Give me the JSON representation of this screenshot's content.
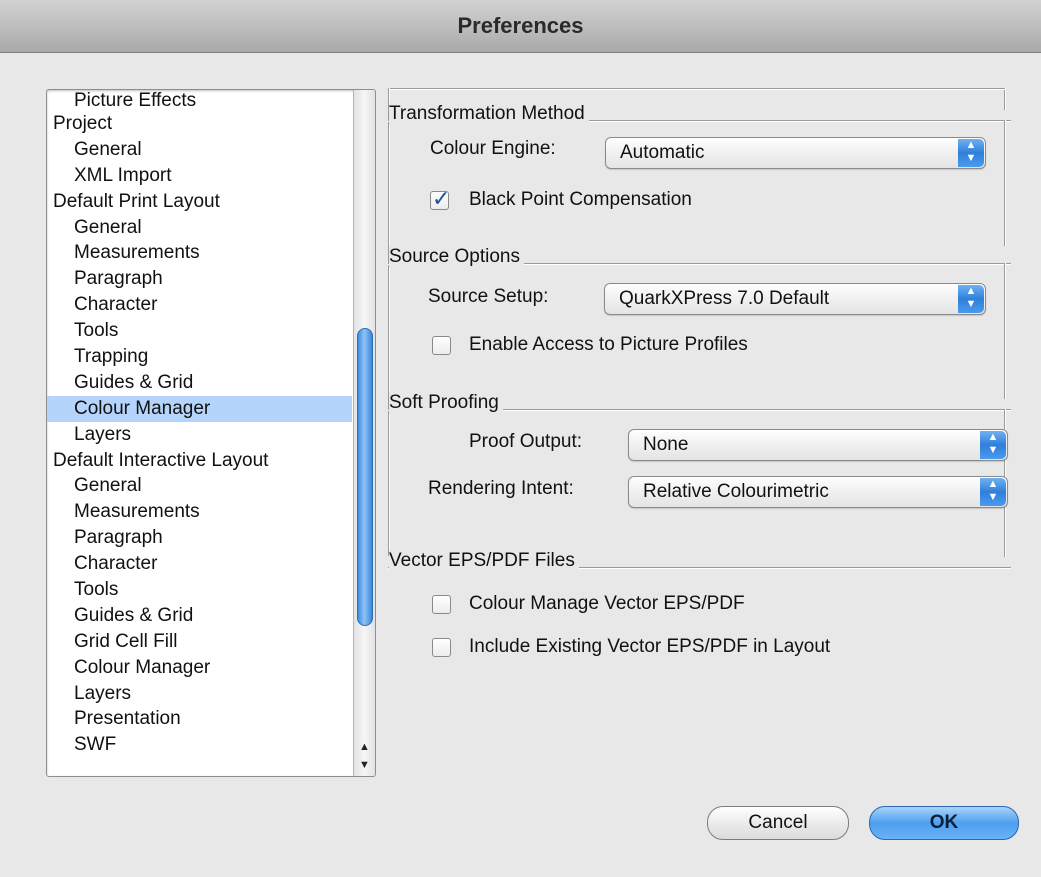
{
  "window": {
    "title": "Preferences"
  },
  "sidebar": {
    "items": [
      {
        "label": "Picture Effects",
        "indent": true
      },
      {
        "label": "Project",
        "indent": false
      },
      {
        "label": "General",
        "indent": true
      },
      {
        "label": "XML Import",
        "indent": true
      },
      {
        "label": "Default Print Layout",
        "indent": false
      },
      {
        "label": "General",
        "indent": true
      },
      {
        "label": "Measurements",
        "indent": true
      },
      {
        "label": "Paragraph",
        "indent": true
      },
      {
        "label": "Character",
        "indent": true
      },
      {
        "label": "Tools",
        "indent": true
      },
      {
        "label": "Trapping",
        "indent": true
      },
      {
        "label": "Guides & Grid",
        "indent": true
      },
      {
        "label": "Colour Manager",
        "indent": true,
        "selected": true
      },
      {
        "label": "Layers",
        "indent": true
      },
      {
        "label": "Default Interactive Layout",
        "indent": false
      },
      {
        "label": "General",
        "indent": true
      },
      {
        "label": "Measurements",
        "indent": true
      },
      {
        "label": "Paragraph",
        "indent": true
      },
      {
        "label": "Character",
        "indent": true
      },
      {
        "label": "Tools",
        "indent": true
      },
      {
        "label": "Guides & Grid",
        "indent": true
      },
      {
        "label": "Grid Cell Fill",
        "indent": true
      },
      {
        "label": "Colour Manager",
        "indent": true
      },
      {
        "label": "Layers",
        "indent": true
      },
      {
        "label": "Presentation",
        "indent": true
      },
      {
        "label": "SWF",
        "indent": true
      }
    ]
  },
  "transformation": {
    "title": "Transformation Method",
    "colour_engine_label": "Colour Engine:",
    "colour_engine_value": "Automatic",
    "black_point_label": "Black Point Compensation",
    "black_point_checked": true
  },
  "source": {
    "title": "Source Options",
    "setup_label": "Source Setup:",
    "setup_value": "QuarkXPress 7.0 Default",
    "enable_access_label": "Enable Access to Picture Profiles",
    "enable_access_checked": false
  },
  "soft_proofing": {
    "title": "Soft Proofing",
    "proof_output_label": "Proof Output:",
    "proof_output_value": "None",
    "rendering_intent_label": "Rendering Intent:",
    "rendering_intent_value": "Relative Colourimetric"
  },
  "vector": {
    "title": "Vector EPS/PDF Files",
    "manage_label": "Colour Manage Vector EPS/PDF",
    "manage_checked": false,
    "include_label": "Include Existing Vector EPS/PDF in Layout",
    "include_checked": false
  },
  "buttons": {
    "cancel": "Cancel",
    "ok": "OK"
  },
  "colors": {
    "selection": "#b5d4fb",
    "accent": "#3a8ee6"
  }
}
